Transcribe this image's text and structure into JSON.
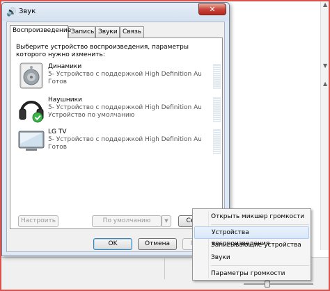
{
  "dialog": {
    "title": "Звук",
    "close_glyph": "✕"
  },
  "tabs": [
    {
      "label": "Воспроизведение",
      "active": true
    },
    {
      "label": "Запись",
      "active": false
    },
    {
      "label": "Звуки",
      "active": false
    },
    {
      "label": "Связь",
      "active": false
    }
  ],
  "instruction": "Выберите устройство воспроизведения, параметры которого нужно изменить:",
  "devices": [
    {
      "name": "Динамики",
      "line2": "5- Устройство с поддержкой High Definition Au...",
      "status": "Готов",
      "icon": "speaker-icon"
    },
    {
      "name": "Наушники",
      "line2": "5- Устройство с поддержкой High Definition Au...",
      "status": "Устройство по умолчанию",
      "icon": "headphones-icon",
      "default": true
    },
    {
      "name": "LG TV",
      "line2": "5- Устройство с поддержкой High Definition Au...",
      "status": "Готов",
      "icon": "tv-icon"
    }
  ],
  "buttons": {
    "configure": "Настроить",
    "set_default": "По умолчанию",
    "properties": "Сво",
    "ok": "OK",
    "cancel": "Отмена",
    "apply": "П"
  },
  "context_menu": {
    "items": [
      {
        "label": "Открыть микшер громкости",
        "highlighted": false
      },
      {
        "label": "Устройства воспроизведения",
        "highlighted": true
      },
      {
        "label": "Записывающие устройства",
        "highlighted": false
      },
      {
        "label": "Звуки",
        "highlighted": false
      },
      {
        "label": "Параметры громкости",
        "highlighted": false
      }
    ]
  },
  "colors": {
    "accent_red": "#d9534f",
    "default_check": "#3bb54a"
  }
}
